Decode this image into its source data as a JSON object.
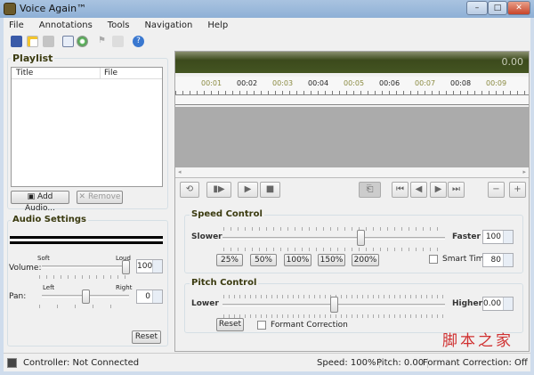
{
  "window": {
    "title": "Voice Again™"
  },
  "menu": [
    "File",
    "Annotations",
    "Tools",
    "Navigation",
    "Help"
  ],
  "toolbar": [
    "open-project-icon",
    "new-icon",
    "save-icon",
    "export-icon",
    "cd-icon",
    "flag-icon",
    "edit-annotation-icon",
    "help-icon"
  ],
  "playlist": {
    "title": "Playlist",
    "columns": [
      "Title",
      "File"
    ],
    "add_label": "Add Audio...",
    "remove_label": "Remove"
  },
  "audio": {
    "title": "Audio Settings",
    "volume_label": "Volume:",
    "soft": "Soft",
    "loud": "Loud",
    "volume": "100",
    "volume_level": 1.0,
    "pan_label": "Pan:",
    "left": "Left",
    "right": "Right",
    "pan": "0",
    "pan_level": 0.5,
    "reset": "Reset"
  },
  "display": {
    "time": "0.00",
    "ticks": [
      "00:01",
      "00:02",
      "00:03",
      "00:04",
      "00:05",
      "00:06",
      "00:07",
      "00:08",
      "00:09"
    ]
  },
  "speed": {
    "title": "Speed Control",
    "slower": "Slower",
    "faster": "Faster",
    "value": "100",
    "level": 0.62,
    "presets": [
      "25%",
      "50%",
      "100%",
      "150%",
      "200%"
    ],
    "smart_time_label": "Smart Time:",
    "smart_time": "80",
    "smart_time_checked": false
  },
  "pitch": {
    "title": "Pitch Control",
    "lower": "Lower",
    "higher": "Higher",
    "value": "0.00",
    "level": 0.5,
    "reset": "Reset",
    "formant_label": "Formant Correction",
    "formant_checked": false
  },
  "status": {
    "controller": "Controller: Not Connected",
    "speed": "Speed: 100%",
    "pitch": "Pitch: 0.00",
    "formant": "Formant Correction: Off"
  },
  "watermark": "脚本之家"
}
